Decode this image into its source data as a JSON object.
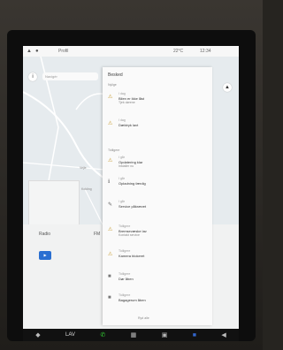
{
  "status": {
    "time": "12:34",
    "temp": "22°C",
    "user": "Profil"
  },
  "map": {
    "search_placeholder": "Navigér",
    "labels": [
      "Vejle",
      "Kolding"
    ]
  },
  "panel": {
    "title": "Besked",
    "section_1": "Nylige",
    "section_2": "Tidligere",
    "notifications": [
      {
        "icon": "warning-icon",
        "time": "I dag",
        "title": "Bilen er ikke låst",
        "subtitle": "Tjek dørene"
      },
      {
        "icon": "warning-icon",
        "time": "I dag",
        "title": "Dæktryk lavt",
        "subtitle": ""
      },
      {
        "icon": "warning-icon",
        "time": "I går",
        "title": "Opdatering klar",
        "subtitle": "Installer nu"
      },
      {
        "icon": "info-icon",
        "time": "I går",
        "title": "Opladning færdig",
        "subtitle": ""
      },
      {
        "icon": "wrench-icon",
        "time": "I går",
        "title": "Service påkrævet",
        "subtitle": ""
      },
      {
        "icon": "warning-icon",
        "time": "Tidligere",
        "title": "Bremsevæske lav",
        "subtitle": "Kontakt service"
      },
      {
        "icon": "warning-icon",
        "time": "Tidligere",
        "title": "Kamera blokeret",
        "subtitle": ""
      },
      {
        "icon": "lock-icon",
        "time": "Tidligere",
        "title": "Dør åben",
        "subtitle": ""
      },
      {
        "icon": "lock-icon",
        "time": "Tidligere",
        "title": "Bagagerum åben",
        "subtitle": ""
      }
    ],
    "footer": "Ryd alle"
  },
  "media": {
    "source": "Radio",
    "station": "FM"
  },
  "taskbar": {
    "climate_label": "LAV"
  }
}
